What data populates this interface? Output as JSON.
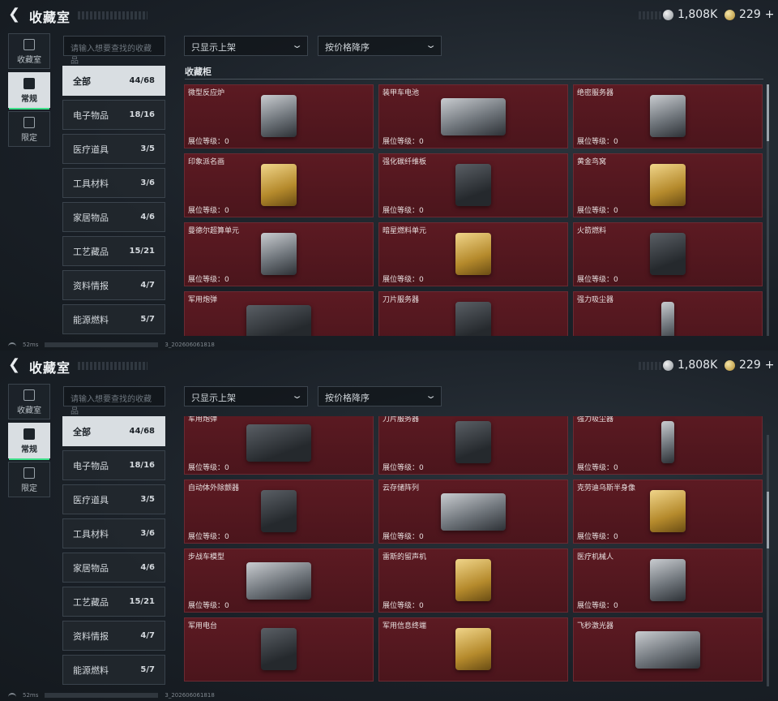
{
  "header": {
    "title": "收藏室"
  },
  "currency": {
    "silver": "1,808K",
    "gold": "229",
    "gold_add": "+"
  },
  "left_tabs": [
    {
      "label": "收藏室"
    },
    {
      "label": "常规"
    },
    {
      "label": "限定"
    }
  ],
  "search": {
    "placeholder": "请输入想要查找的收藏品"
  },
  "filters": {
    "display": "只显示上架",
    "sort": "按价格降序"
  },
  "section_title": "收藏柜",
  "categories": [
    {
      "label": "全部",
      "count": "44/68"
    },
    {
      "label": "电子物品",
      "count": "18/16"
    },
    {
      "label": "医疗道具",
      "count": "3/5"
    },
    {
      "label": "工具材料",
      "count": "3/6"
    },
    {
      "label": "家居物品",
      "count": "4/6"
    },
    {
      "label": "工艺藏品",
      "count": "15/21"
    },
    {
      "label": "资料情报",
      "count": "4/7"
    },
    {
      "label": "能源燃料",
      "count": "5/7"
    }
  ],
  "level_label": "展位等级：0",
  "items": [
    {
      "name": "微型反应炉"
    },
    {
      "name": "装甲车电池"
    },
    {
      "name": "绝密服务器"
    },
    {
      "name": "印象派名画"
    },
    {
      "name": "强化碳纤维板"
    },
    {
      "name": "黄金鸟窝"
    },
    {
      "name": "曼德尔超算单元"
    },
    {
      "name": "暗星燃料单元"
    },
    {
      "name": "火箭燃料"
    },
    {
      "name": "军用炮弹"
    },
    {
      "name": "刀片服务器"
    },
    {
      "name": "强力吸尘器"
    },
    {
      "name": "自动体外除颤器"
    },
    {
      "name": "云存储阵列"
    },
    {
      "name": "克劳迪乌斯半身像"
    },
    {
      "name": "步战车模型"
    },
    {
      "name": "雷斯的留声机"
    },
    {
      "name": "医疗机械人"
    },
    {
      "name": "军用电台"
    },
    {
      "name": "军用信息终端"
    },
    {
      "name": "飞秒激光器"
    }
  ],
  "status": {
    "ping": "52ms",
    "build_suffix": "3_202606061818"
  }
}
